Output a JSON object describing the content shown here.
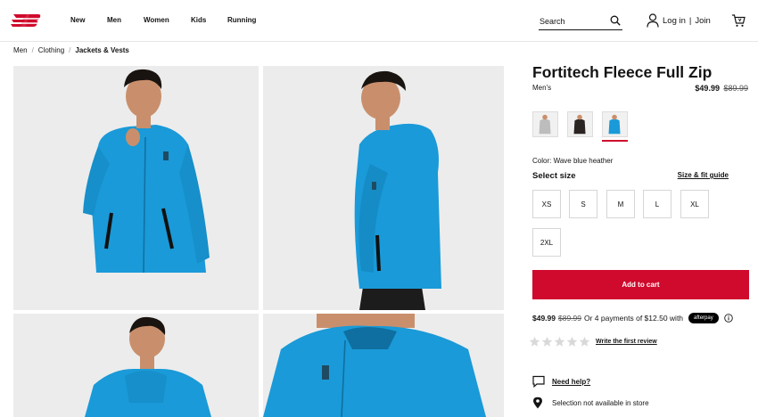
{
  "brand": {
    "logo_icon": "new-balance-logo-icon",
    "accent": "#cf0a2c"
  },
  "nav": [
    "New",
    "Men",
    "Women",
    "Kids",
    "Running"
  ],
  "search": {
    "placeholder": "Search",
    "icon": "search-icon"
  },
  "account": {
    "login": "Log in",
    "separator": "|",
    "join": "Join",
    "icon": "user-icon"
  },
  "cart": {
    "icon": "cart-icon"
  },
  "breadcrumb": [
    "Men",
    "Clothing",
    "Jackets & Vests"
  ],
  "gallery": {
    "product_color": "#1a9ad8",
    "background": "#ececec"
  },
  "product": {
    "title": "Fortitech Fleece Full Zip",
    "category": "Men's",
    "price": "$49.99",
    "was_price": "$89.99",
    "swatch_colors": [
      "#bdbdbd",
      "#2a2422",
      "#1a9ad8"
    ],
    "selected_swatch": 2,
    "color_label": "Color: Wave blue heather",
    "select_size_label": "Select size",
    "size_guide_label": "Size & fit guide",
    "sizes": [
      "XS",
      "S",
      "M",
      "L",
      "XL",
      "2XL"
    ],
    "add_to_cart_label": "Add to cart",
    "afterpay_text": "Or 4 payments of $12.50 with",
    "afterpay_badge": "afterpay",
    "rating": 0,
    "review_link": "Write the first review",
    "help_label": "Need help?",
    "store_label": "Selection not available in store"
  }
}
